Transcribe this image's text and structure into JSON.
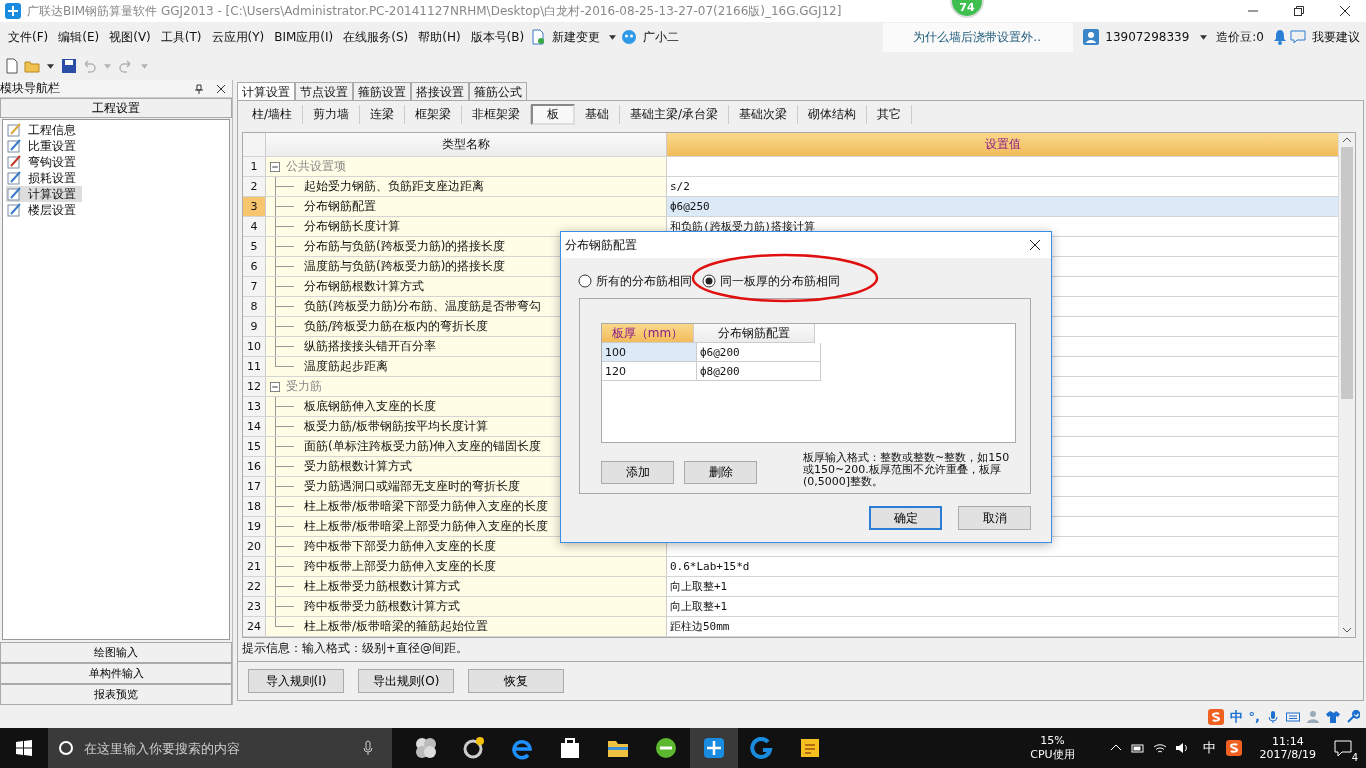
{
  "window": {
    "title": "广联达BIM钢筋算量软件 GGJ2013 - [C:\\Users\\Administrator.PC-20141127NRHM\\Desktop\\白龙村-2016-08-25-13-27-07(2166版)_16G.GGJ12]",
    "badge": "74"
  },
  "menu": [
    "文件(F)",
    "编辑(E)",
    "视图(V)",
    "工具(T)",
    "云应用(Y)",
    "BIM应用(I)",
    "在线服务(S)",
    "帮助(H)",
    "版本号(B)"
  ],
  "menu_extra": {
    "new_change": "新建变更",
    "assistant": "广小二"
  },
  "top_right": {
    "question": "为什么墙后浇带设置外..",
    "user": "13907298339",
    "beans": "造价豆:0",
    "suggest": "我要建议"
  },
  "nav": {
    "title": "模块导航栏",
    "section": "工程设置",
    "items": [
      {
        "label": "工程信息",
        "selected": false
      },
      {
        "label": "比重设置",
        "selected": false
      },
      {
        "label": "弯钩设置",
        "selected": false
      },
      {
        "label": "损耗设置",
        "selected": false
      },
      {
        "label": "计算设置",
        "selected": true
      },
      {
        "label": "楼层设置",
        "selected": false
      }
    ],
    "bottom": [
      "绘图输入",
      "单构件输入",
      "报表预览"
    ]
  },
  "tabs": [
    {
      "label": "计算设置",
      "selected": true
    },
    {
      "label": "节点设置",
      "selected": false
    },
    {
      "label": "箍筋设置",
      "selected": false
    },
    {
      "label": "搭接设置",
      "selected": false
    },
    {
      "label": "箍筋公式",
      "selected": false
    }
  ],
  "subtabs": [
    {
      "label": "柱/墙柱",
      "selected": false
    },
    {
      "label": "剪力墙",
      "selected": false
    },
    {
      "label": "连梁",
      "selected": false
    },
    {
      "label": "框架梁",
      "selected": false
    },
    {
      "label": "非框架梁",
      "selected": false
    },
    {
      "label": "板",
      "selected": true
    },
    {
      "label": "基础",
      "selected": false
    },
    {
      "label": "基础主梁/承台梁",
      "selected": false
    },
    {
      "label": "基础次梁",
      "selected": false
    },
    {
      "label": "砌体结构",
      "selected": false
    },
    {
      "label": "其它",
      "selected": false
    }
  ],
  "grid": {
    "columns": [
      "类型名称",
      "设置值"
    ],
    "groups": [
      {
        "num": "1",
        "name": "公共设置项",
        "expanded": true,
        "children": [
          {
            "num": "2",
            "name": "起始受力钢筋、负筋距支座边距离",
            "value": "s/2",
            "selected": false
          },
          {
            "num": "3",
            "name": "分布钢筋配置",
            "value": "ф6@250",
            "selected": true
          },
          {
            "num": "4",
            "name": "分布钢筋长度计算",
            "value": "和负筋(跨板受力筋)搭接计算",
            "selected": false
          },
          {
            "num": "5",
            "name": "分布筋与负筋(跨板受力筋)的搭接长度",
            "selected": false
          },
          {
            "num": "6",
            "name": "温度筋与负筋(跨板受力筋)的搭接长度",
            "selected": false
          },
          {
            "num": "7",
            "name": "分布钢筋根数计算方式",
            "selected": false
          },
          {
            "num": "8",
            "name": "负筋(跨板受力筋)分布筋、温度筋是否带弯勾",
            "selected": false
          },
          {
            "num": "9",
            "name": "负筋/跨板受力筋在板内的弯折长度",
            "selected": false
          },
          {
            "num": "10",
            "name": "纵筋搭接接头错开百分率",
            "selected": false
          },
          {
            "num": "11",
            "name": "温度筋起步距离",
            "selected": false
          }
        ]
      },
      {
        "num": "12",
        "name": "受力筋",
        "expanded": true,
        "children": [
          {
            "num": "13",
            "name": "板底钢筋伸入支座的长度",
            "selected": false
          },
          {
            "num": "14",
            "name": "板受力筋/板带钢筋按平均长度计算",
            "selected": false
          },
          {
            "num": "15",
            "name": "面筋(单标注跨板受力筋)伸入支座的锚固长度",
            "selected": false
          },
          {
            "num": "16",
            "name": "受力筋根数计算方式",
            "selected": false
          },
          {
            "num": "17",
            "name": "受力筋遇洞口或端部无支座时的弯折长度",
            "selected": false
          },
          {
            "num": "18",
            "name": "柱上板带/板带暗梁下部受力筋伸入支座的长度",
            "selected": false
          },
          {
            "num": "19",
            "name": "柱上板带/板带暗梁上部受力筋伸入支座的长度",
            "selected": false
          },
          {
            "num": "20",
            "name": "跨中板带下部受力筋伸入支座的长度",
            "selected": false
          },
          {
            "num": "21",
            "name": "跨中板带上部受力筋伸入支座的长度",
            "value": "0.6*Lab+15*d",
            "selected": false
          },
          {
            "num": "22",
            "name": "柱上板带受力筋根数计算方式",
            "value": "向上取整+1",
            "selected": false
          },
          {
            "num": "23",
            "name": "跨中板带受力筋根数计算方式",
            "value": "向上取整+1",
            "selected": false
          },
          {
            "num": "24",
            "name": "柱上板带/板带暗梁的箍筋起始位置",
            "value": "距柱边50mm",
            "selected": false
          }
        ]
      }
    ]
  },
  "hint": "提示信息：输入格式：级别+直径@间距。",
  "buttons": [
    "导入规则(I)",
    "导出规则(O)",
    "恢复"
  ],
  "dialog": {
    "title": "分布钢筋配置",
    "radios": [
      {
        "label": "所有的分布筋相同",
        "selected": false
      },
      {
        "label": "同一板厚的分布筋相同",
        "selected": true
      }
    ],
    "columns": [
      "板厚（mm）",
      "分布钢筋配置"
    ],
    "rows": [
      {
        "thickness": "100",
        "config": "ф6@200",
        "selected": true
      },
      {
        "thickness": "120",
        "config": "ф8@200",
        "selected": false
      }
    ],
    "actions": [
      "添加",
      "删除"
    ],
    "note": "板厚输入格式：整数或整数~整数，如150或150~200.板厚范围不允许重叠，板厚(0,5000]整数。",
    "ok": "确定",
    "cancel": "取消"
  },
  "ime": {
    "lang": "中",
    "punct": "°,"
  },
  "taskbar": {
    "search_placeholder": "在这里输入你要搜索的内容",
    "cpu": "15%",
    "cpu_label": "CPU使用",
    "lang": "中",
    "time": "11:14",
    "date": "2017/8/19",
    "notifications": "4"
  }
}
